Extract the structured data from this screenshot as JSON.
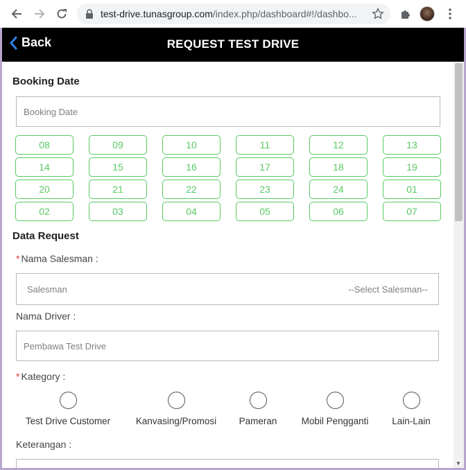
{
  "browser": {
    "url_domain": "test-drive.tunasgroup.com",
    "url_path": "/index.php/dashboard#!/dashbo..."
  },
  "appbar": {
    "back_label": "Back",
    "title": "REQUEST TEST DRIVE"
  },
  "booking": {
    "section_title": "Booking Date",
    "placeholder": "Booking Date",
    "dates": [
      "08",
      "09",
      "10",
      "11",
      "12",
      "13",
      "14",
      "15",
      "16",
      "17",
      "18",
      "19",
      "20",
      "21",
      "22",
      "23",
      "24",
      "01",
      "02",
      "03",
      "04",
      "05",
      "06",
      "07"
    ]
  },
  "request": {
    "section_title": "Data Request",
    "salesman_label": "Nama Salesman :",
    "salesman_placeholder": "Salesman",
    "salesman_select": "--Select Salesman--",
    "driver_label": "Nama Driver :",
    "driver_placeholder": "Pembawa Test Drive",
    "kategory_label": "Kategory :",
    "kategory_options": [
      "Test Drive Customer",
      "Kanvasing/Promosi",
      "Pameran",
      "Mobil Pengganti",
      "Lain-Lain"
    ],
    "keterangan_label": "Keterangan :",
    "required_mark": "*"
  },
  "colors": {
    "accent_green": "#58c963",
    "required_red": "#e53935",
    "appbar_bg": "#000000"
  }
}
